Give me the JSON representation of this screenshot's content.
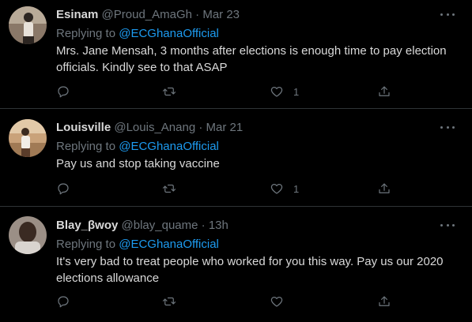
{
  "tweets": [
    {
      "name": "Esinam",
      "handle": "@Proud_AmaGh",
      "separator": "·",
      "date": "Mar 23",
      "replying_prefix": "Replying to",
      "replying_to": "@ECGhanaOfficial",
      "text": "Mrs. Jane Mensah, 3 months after elections is enough time  to pay election officials. Kindly see to that ASAP",
      "like_count": "1",
      "avatar_colors": {
        "bg": "#8a7868",
        "figure": "#2c2521"
      }
    },
    {
      "name": "Louisville",
      "handle": "@Louis_Anang",
      "separator": "·",
      "date": "Mar 21",
      "replying_prefix": "Replying to",
      "replying_to": "@ECGhanaOfficial",
      "text": "Pay us and stop taking vaccine",
      "like_count": "1",
      "avatar_colors": {
        "bg": "#c9a27a",
        "figure": "#3b2a1f"
      }
    },
    {
      "name": "Blay_βwoy",
      "handle": "@blay_quame",
      "separator": "·",
      "date": "13h",
      "replying_prefix": "Replying to",
      "replying_to": "@ECGhanaOfficial",
      "text": "It's very bad to treat people who worked for you this way. Pay us our 2020 elections allowance",
      "like_count": "",
      "avatar_colors": {
        "bg": "#9b8f86",
        "figure": "#3a2a22"
      }
    }
  ],
  "icons": [
    "reply-icon",
    "retweet-icon",
    "like-icon",
    "share-icon",
    "more-icon"
  ],
  "colors": {
    "background": "#000000",
    "text": "#d9d9d9",
    "muted": "#6e767d",
    "link": "#1d9bf0",
    "divider": "#2f3336"
  }
}
